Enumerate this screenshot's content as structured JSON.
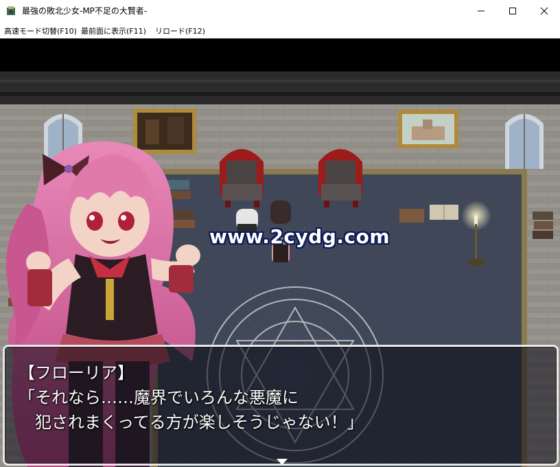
{
  "window": {
    "title": "最強の敗北少女-MP不足の大賢者-",
    "icon": "game-app-icon",
    "controls": [
      "minimize-icon",
      "maximize-icon",
      "close-icon"
    ]
  },
  "menu": {
    "items": [
      {
        "label": "高速モード切替(F10)"
      },
      {
        "label": "最前面に表示(F11)"
      },
      {
        "label": "リロード(F12)"
      }
    ]
  },
  "scene": {
    "watermark": "www.2cydg.com",
    "colors": {
      "wall": "#8d8a85",
      "carpet": "#3f4758",
      "carpet_border": "#8a7a4e",
      "character_hair": "#d9679c",
      "chair_frame": "#9c1b1b"
    }
  },
  "dialog": {
    "speaker": "【フローリア】",
    "line1": "「それなら……魔界でいろんな悪魔に",
    "line2": "犯されまくってる方が楽しそうじゃない！」",
    "continue_icon": "next-page-arrow-icon"
  }
}
